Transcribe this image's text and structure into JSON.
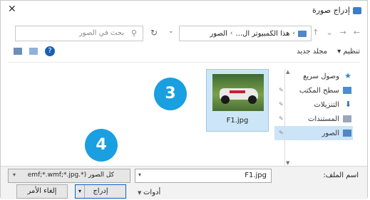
{
  "window": {
    "title": "إدراج صورة",
    "close_glyph": "✕",
    "accent": "#1a9fe0"
  },
  "nav": {
    "back_glyph": "←",
    "forward_glyph": "→",
    "up_glyph": "↑",
    "refresh_glyph": "↻",
    "dropdown_glyph": "⌄",
    "breadcrumbs": [
      "هذا الكمبيوتر ال...",
      "الصور"
    ],
    "search_placeholder": "بحث في الصور",
    "search_icon": "magnifier-icon"
  },
  "toolbar": {
    "organize_label": "تنظيم ▾",
    "new_folder_label": "مجلد جديد",
    "help_glyph": "?"
  },
  "sidebar": {
    "items": [
      {
        "label": "وصول سريع",
        "icon": "star-icon",
        "color": "#3b82c4"
      },
      {
        "label": "سطح المكتب",
        "icon": "desktop-icon",
        "color": "#4a8fd0"
      },
      {
        "label": "التنزيلات",
        "icon": "download-icon",
        "color": "#2f6fb8"
      },
      {
        "label": "المستندات",
        "icon": "documents-icon",
        "color": "#7f8fa6"
      },
      {
        "label": "الصور",
        "icon": "pictures-icon",
        "color": "#4f88c6",
        "selected": true
      }
    ]
  },
  "files": [
    {
      "name": "F1.jpg",
      "thumbnail": "race-car-image"
    }
  ],
  "badges": [
    "3",
    "4"
  ],
  "bottom": {
    "filename_label": "اسم الملف:",
    "filename_value": "F1.jpg",
    "filetype_value": "كل الصور (*.emf;*.wmf;*.jpg",
    "tools_label": "أدوات",
    "insert_label": "إدراج",
    "cancel_label": "إلغاء الأمر"
  }
}
